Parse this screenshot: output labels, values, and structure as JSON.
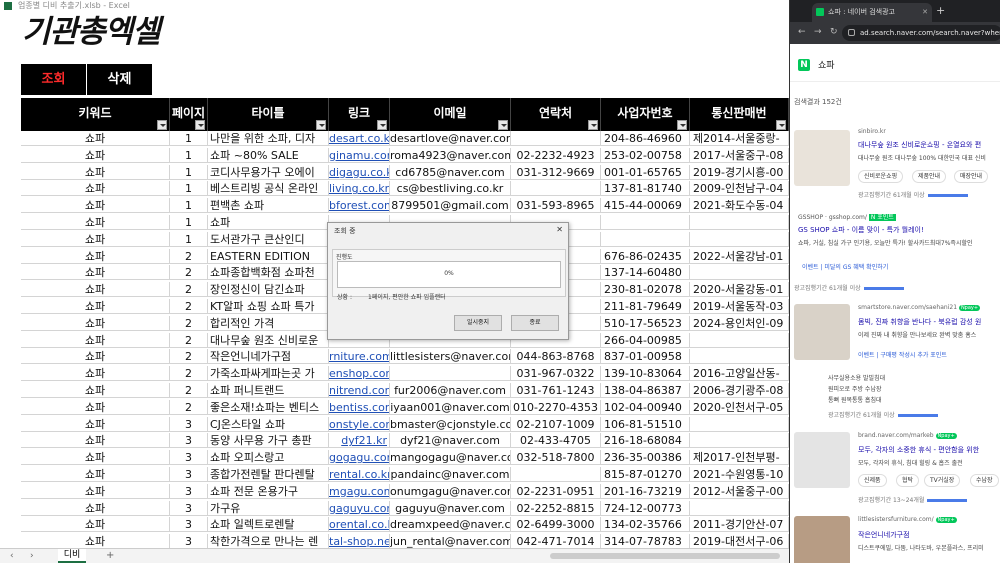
{
  "excel": {
    "window_title": "업종별 디비 추출기.xlsb - Excel",
    "logo_text": "기관총엑셀",
    "buttons": {
      "search": "조회",
      "delete": "삭제"
    },
    "headers": [
      "키워드",
      "페이지",
      "타이틀",
      "링크",
      "이메일",
      "연락처",
      "사업자번호",
      "통신판매번"
    ],
    "rows": [
      [
        "쇼파",
        "1",
        "나만을 위한 소파, 디자",
        "desart.co.kr",
        "desartlove@naver.com",
        "",
        "204-86-46960",
        "제2014-서울중랑-"
      ],
      [
        "쇼파",
        "1",
        "쇼파 ~80% SALE",
        "ginamu.com",
        "roma4923@naver.com",
        "02-2232-4923",
        "253-02-00758",
        "2017-서울중구-08"
      ],
      [
        "쇼파",
        "1",
        "코디사무용가구 오에이",
        "digagu.co.kr",
        "cd6785@naver.com",
        "031-312-9669",
        "001-01-65765",
        "2019-경기시흥-00"
      ],
      [
        "쇼파",
        "1",
        "베스트리빙 공식 온라인",
        "living.co.kr/",
        "cs@bestliving.co.kr",
        "",
        "137-81-81740",
        "2009-인천남구-04"
      ],
      [
        "쇼파",
        "1",
        "편백촌 쇼파",
        "bforest.com",
        "8799501@gmail.com",
        "031-593-8965",
        "415-44-00069",
        "2021-화도수동-04"
      ],
      [
        "쇼파",
        "1",
        "쇼파",
        "",
        "",
        "",
        "",
        ""
      ],
      [
        "쇼파",
        "1",
        "도서관가구 큰산인디",
        "",
        "",
        "",
        "",
        ""
      ],
      [
        "쇼파",
        "2",
        "EASTERN EDITION",
        "",
        "",
        "",
        "676-86-02435",
        "2022-서울강남-01"
      ],
      [
        "쇼파",
        "2",
        "쇼파종합백화점 쇼파천",
        "",
        "",
        "8527",
        "137-14-60480",
        ""
      ],
      [
        "쇼파",
        "2",
        "장인정신이 담긴쇼파",
        "",
        "",
        "4057",
        "230-81-02078",
        "2020-서울강동-01"
      ],
      [
        "쇼파",
        "2",
        "KT알파 쇼핑 쇼파 특가",
        "",
        "",
        "",
        "211-81-79649",
        "2019-서울동작-03"
      ],
      [
        "쇼파",
        "2",
        "합리적인 가격",
        "",
        "",
        "6579",
        "510-17-56523",
        "2024-용인처인-09"
      ],
      [
        "쇼파",
        "2",
        "대나무숲 원조 신비로운",
        "",
        "",
        "",
        "266-04-00985",
        ""
      ],
      [
        "쇼파",
        "2",
        "작은언니네가구점",
        "rniture.com/",
        "littlesisters@naver.com",
        "044-863-8768",
        "837-01-00958",
        ""
      ],
      [
        "쇼파",
        "2",
        "가죽소파싸게파는곳 가",
        "enshop.com",
        "",
        "031-967-0322",
        "139-10-83064",
        "2016-고양일산동-"
      ],
      [
        "쇼파",
        "2",
        "쇼파 퍼니트랜드",
        "nitrend.com",
        "fur2006@naver.com",
        "031-761-1243",
        "138-04-86387",
        "2006-경기광주-08"
      ],
      [
        "쇼파",
        "2",
        "좋은소재!쇼파는 벤티스",
        "bentiss.com",
        "iyaan001@naver.com",
        "010-2270-4353",
        "102-04-00940",
        "2020-인천서구-05"
      ],
      [
        "쇼파",
        "3",
        "CJ온스타일 쇼파",
        "onstyle.com",
        "bmaster@cjonstyle.com",
        "02-2107-1009",
        "106-81-51510",
        ""
      ],
      [
        "쇼파",
        "3",
        "동양 사무용 가구 총판",
        "dyf21.kr",
        "dyf21@naver.com",
        "02-433-4705",
        "216-18-68084",
        ""
      ],
      [
        "쇼파",
        "3",
        "쇼파 오피스랑고",
        "gogagu.com",
        "mangogagu@naver.com",
        "032-518-7800",
        "236-35-00386",
        "제2017-인천부평-"
      ],
      [
        "쇼파",
        "3",
        "종합가전렌탈 판다렌탈",
        "rental.co.kr",
        "pandainc@naver.com",
        "",
        "815-87-01270",
        "2021-수원영통-10"
      ],
      [
        "쇼파",
        "3",
        "쇼파 전문 온용가구",
        "mgagu.com/",
        "onumgagu@naver.com",
        "02-2231-0951",
        "201-16-73219",
        "2012-서울중구-00"
      ],
      [
        "쇼파",
        "3",
        "가구유",
        "gaguyu.com",
        "gaguyu@naver.com",
        "02-2252-8815",
        "724-12-00773",
        ""
      ],
      [
        "쇼파",
        "3",
        "쇼파 일렉트로렌탈",
        "orental.co.kr",
        "dreamxpeed@naver.com",
        "02-6499-3000",
        "134-02-35766",
        "2011-경기안산-07"
      ],
      [
        "쇼파",
        "3",
        "착한가격으로 만나는 렌",
        "tal-shop.net",
        "jun_rental@naver.com",
        "042-471-7014",
        "314-07-78783",
        "2019-대전서구-06"
      ]
    ],
    "sheet_tab": "디비",
    "nav_prev": "‹",
    "nav_next": "›",
    "add_tab": "+"
  },
  "dialog": {
    "title": "조회 중",
    "close": "✕",
    "progress_label": "진행도",
    "progress_pct": "0%",
    "status_label": "상황 :",
    "status_text": "1페이지, 편안한 쇼파 임플랜터",
    "pause_btn": "일시중지",
    "end_btn": "종료"
  },
  "browser": {
    "tab_title": "쇼파 : 네이버 검색광고",
    "tab_close": "✕",
    "new_tab": "+",
    "url": "ad.search.naver.com/search.naver?where",
    "back": "←",
    "forward": "→",
    "reload": "↻",
    "search_query": "쇼파",
    "naver_n": "N",
    "result_count": "검색결과 152건",
    "ad1": {
      "src": "sinbiro.kr",
      "title": "대나무숲 원조 신비로운쇼핑 - 온열요와 편",
      "desc": "대나무숲 원조 대나무숲 100% 대한민국 대표 신비",
      "pills": [
        "신비로운쇼핑",
        "제품안내",
        "매장안내"
      ],
      "period": "광고집행기간 61개월 이상"
    },
    "ad2": {
      "src": "GSSHOP · gsshop.com/",
      "tag": "N 포인트",
      "title": "GS SHOP 쇼파 - 이름 맞이 - 특가 뭘레이!",
      "desc": "쇼파, 거실, 침실 가구 인기용, 오늘만 특가! 할사카드최대7%즉시할인",
      "event": "이벤트 | 미달의 GS 혜택 확인하기",
      "period": "광고집행기간 61개월 이상"
    },
    "ad3": {
      "src": "smartstore.naver.com/saehani21",
      "title": "몸빅, 진짜 취향을 반나다 - 북유럽 감성 원",
      "desc": "이제 진짜 내 취향을 만나보세요 완벽 맞춤 홈스",
      "event": "이벤트 | 구매평 작성시 추가 포인트",
      "links": [
        "사무실용소용 발빌침대",
        "원피오로 주방 수납장",
        "통뼈 원목통통 흡침대"
      ],
      "period": "광고집행기간 61개월 이상"
    },
    "ad4": {
      "src": "brand.naver.com/markeb",
      "title": "모두, 각자의 소중한 휴식 - 편안함을 위한",
      "desc": "모두, 각자의 휴식, 침대 힐링 & 흡즈 출전",
      "pills": [
        "신제품",
        "협탁",
        "TV거실장",
        "수납장"
      ],
      "period": "광고집행기간 13~24개월"
    },
    "ad5": {
      "src": "littlesistersfurniture.com/",
      "title": "작은언니네가구점",
      "desc": "디스트쿠에밀, 다뚬, 나타도바, 우본플라스, 프리미"
    },
    "npay": "Npay+"
  }
}
